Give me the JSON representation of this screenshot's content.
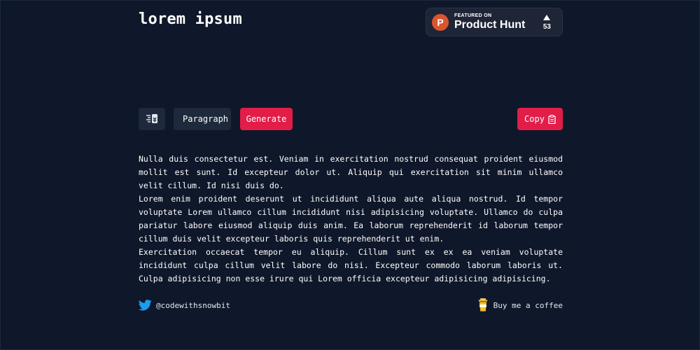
{
  "header": {
    "title": "lorem ipsum"
  },
  "product_hunt": {
    "featured_label": "FEATURED ON",
    "name": "Product Hunt",
    "logo_letter": "P",
    "votes": "53",
    "brand_color": "#da552f"
  },
  "toolbar": {
    "settings_icon": "sliders-icon",
    "type_value": "Paragraph",
    "generate_label": "Generate",
    "copy_label": "Copy",
    "copy_icon": "clipboard-icon"
  },
  "content": {
    "paragraphs": [
      "Nulla duis consectetur est. Veniam in exercitation nostrud consequat proident eiusmod mollit est sunt. Id excepteur dolor ut. Aliquip qui exercitation sit minim ullamco velit cillum. Id nisi duis do.",
      "Lorem enim proident deserunt ut incididunt aliqua aute aliqua nostrud. Id tempor voluptate Lorem ullamco cillum incididunt nisi adipisicing voluptate. Ullamco do culpa pariatur labore eiusmod aliquip duis anim. Ea laborum reprehenderit id laborum tempor cillum duis velit excepteur laboris quis reprehenderit ut enim.",
      "Exercitation occaecat tempor eu aliquip. Cillum sunt ex ex ea veniam voluptate incididunt culpa cillum velit labore do nisi. Excepteur commodo laborum laboris ut. Culpa adipisicing non esse irure qui Lorem officia excepteur adipisicing adipisicing."
    ]
  },
  "footer": {
    "twitter_handle": "@codewithsnowbit",
    "coffee_label": "Buy me a coffee",
    "twitter_icon": "twitter-icon",
    "coffee_icon": "coffee-cup-icon"
  },
  "colors": {
    "background": "#0f172a",
    "surface": "#1e293b",
    "accent": "#e11d48",
    "twitter": "#1d9bf0",
    "coffee": "#fbbf24"
  }
}
